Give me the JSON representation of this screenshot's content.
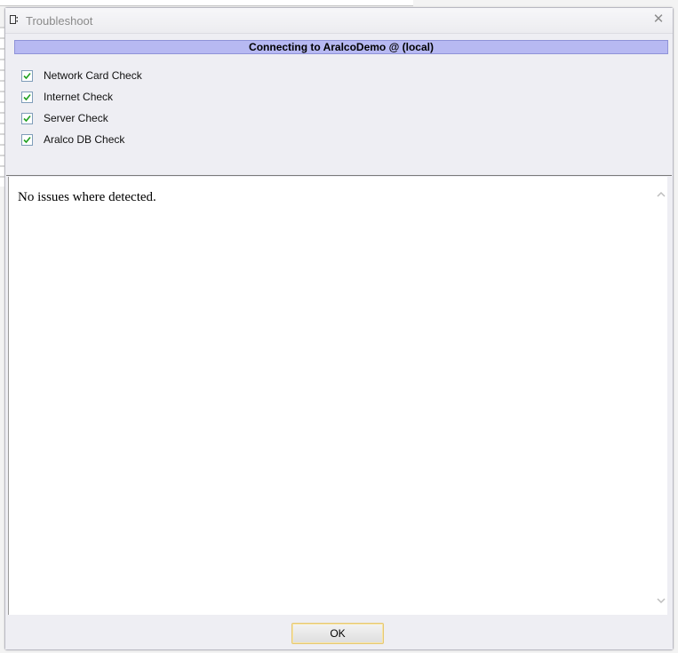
{
  "window": {
    "title": "Troubleshoot",
    "close_symbol": "✕",
    "title_icon": "window-icon",
    "close_icon": "close-icon"
  },
  "banner": {
    "text": "Connecting to AralcoDemo @ (local)",
    "color": "#b7b9f2"
  },
  "checks": [
    {
      "label": "Network Card Check",
      "checked": true
    },
    {
      "label": "Internet Check",
      "checked": true
    },
    {
      "label": "Server Check",
      "checked": true
    },
    {
      "label": "Aralco DB Check",
      "checked": true
    }
  ],
  "results": {
    "text": "No issues where detected."
  },
  "footer": {
    "ok_label": "OK"
  }
}
